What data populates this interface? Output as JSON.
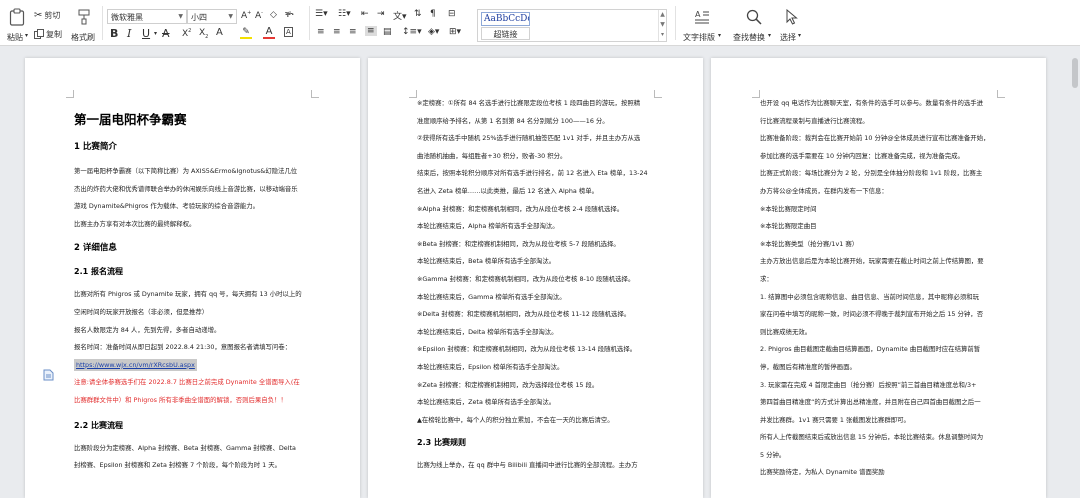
{
  "ribbon": {
    "paste": "粘贴",
    "cut": "剪切",
    "copy": "复制",
    "format_painter": "格式刷",
    "font_name": "微软雅黑",
    "font_size": "小四",
    "style_normal": "AaBbCcDd",
    "style_hyperlink": "超链接",
    "text_layout": "文字排版",
    "find_replace": "查找替换",
    "select": "选择",
    "colors": {
      "highlight": "#f3e000",
      "font_red": "#e53935",
      "brand_blue": "#2b579a"
    }
  },
  "page1": {
    "title": "第一届电阳杯争霸赛",
    "s1": "1  比赛简介",
    "s1_lines": [
      "第一届电阳杯争霸赛（以下简称比赛）为 AXIS5&Ermo&Ignotus&幻隐法几位",
      "杰出的炸药大佬和优秀谱师联合举办的休闲娱乐向线上音游比赛，以移动端音乐",
      "游戏 Dynamite&Phigros 作为载体、考验玩家的综合音游能力。",
      "比赛主办方享有对本次比赛的最终解释权。"
    ],
    "s2": "2  详细信息",
    "s21": "2.1  报名流程",
    "s21_lines": [
      "比赛对所有 Phigros 或 Dynamite 玩家，拥有 qq 号，每天拥有 13 小时以上的",
      "空闲时间的玩家开放报名（非必须，但是推荐）",
      "报名人数限定为 84 人，先到先得，多者自动递增。",
      "报名时间：准备时间从即日起到 2022.8.4 21:30，意图报名者请填写问卷："
    ],
    "link": "https://www.wjx.cn/vm/rXRcsbU.aspx",
    "warn1": "注意:请全体参赛选手们在 2022.8.7 比赛日之前完成 Dynamite 全谱面导入(在",
    "warn2": "比赛群群文件中）和 Phigros 所有非季曲全谱面的解锁，否则后果自负！！",
    "s22": "2.2  比赛流程",
    "s22_lines": [
      "比赛阶段分为定榜赛、Alpha 封榜赛、Beta 封榜赛、Gamma 封榜赛、Delta",
      "封榜赛、Epsilon 封榜赛和 Zeta 封榜赛 7 个阶段，每个阶段为时 1 天。"
    ]
  },
  "page2": {
    "lines_a": [
      "※定榜赛：①所有 84 名选手进行比赛限定段位考核 1 段四曲目的游玩，按照精",
      "准度顺序给予排名，从第 1 名到第 84 名分别赋分 100——16 分。",
      "②获得所有选手中随机 25%选手进行随机抽签匹配 1v1 对手，并且主办方从选",
      "曲池随机抽曲，每组胜者+30 积分，败者-30 积分。",
      "结束后，按照本轮积分顺序对所有选手进行排名，前 12 名进入 Eta 榜单，13-24",
      "名进入 Zeta 榜单……以此类推，最后 12 名进入 Alpha 榜单。",
      "※Alpha 封榜赛：和定榜赛机制相同，改为从段位考核 2-4 段随机选择。",
      "本轮比赛结束后，Alpha 榜单所有选手全部淘汰。",
      "※Beta 封榜赛：和定榜赛机制相同，改为从段位考核 5-7 段随机选择。",
      "本轮比赛结束后，Beta 榜单所有选手全部淘汰。",
      "※Gamma 封榜赛：和定榜赛机制相同，改为从段位考核 8-10 段随机选择。",
      "本轮比赛结束后，Gamma 榜单所有选手全部淘汰。",
      "※Delta 封榜赛：和定榜赛机制相同，改为从段位考核 11-12 段随机选择。",
      "本轮比赛结束后，Delta 榜单所有选手全部淘汰。",
      "※Epsilon 封榜赛：和定榜赛机制相同，改为从段位考核 13-14 段随机选择。",
      "本轮比赛结束后，Epsilon 榜单所有选手全部淘汰。",
      "※Zeta 封榜赛：和定榜赛机制相同，改为选择段位考核 15 段。",
      "本轮比赛结束后，Zeta 榜单所有选手全部淘汰。",
      "▲在榜轮比赛中，每个人的积分独立累加，不会在一天的比赛后清空。"
    ],
    "s23": "2.3  比赛规则",
    "lines_b": [
      "比赛为线上举办，在 qq 群中与 Bilibili 直播间中进行比赛的全部流程。主办方"
    ]
  },
  "page3": {
    "lines": [
      "也开设 qq 电话作为比赛聊天室，有条件的选手可以参与。数量有条件的选手进",
      "行比赛流程录制与直播进行比赛流程。",
      "比赛准备阶段：裁判会在比赛开始前 10 分钟@全体成员进行宣布比赛准备开始，",
      "参加比赛的选手需要在 10 分钟内回复：比赛准备完成，视为准备完成。",
      "比赛正式阶段：每场比赛分为 2 轮，分别是全体抽分阶段和 1v1 阶段，比赛主",
      "办方将公@全体成员，在群内发布一下信息：",
      "※本轮比赛限定时间",
      "※本轮比赛限定曲目",
      "※本轮比赛类型（抢分赛/1v1 赛）",
      "主办方放出信息后是为本轮比赛开始，玩家需要在截止时间之前上传结算图，要",
      "求：",
      "1. 结算图中必须包含昵称信息、曲目信息、当前时间信息，其中昵称必须和玩",
      "家在问卷中填写的昵称一致，时间必须不得晚于裁判宣布开始之后 15 分钟，否",
      "则比赛成绩无效。",
      "2. Phigros 曲目截图定截曲目结算画面，Dynamite 曲目截图时应在结算前暂",
      "停，截图后有精准度的暂停画面。",
      "3. 玩家需在完成 4 首限定曲目（抢分赛）后按照”前三首曲目精准度总和/3+",
      "第四首曲目精准度“的方式计算出总精准度，并且附在自己四首曲目截图之后一",
      "并发比赛群。1v1 赛只需要 1 张截图发比赛群即可。",
      "所有人上传截图结束后或放出信息 15 分钟后，本轮比赛结束。休息调整时间为",
      "5 分钟。",
      "比赛奖励待定，为私人 Dynamite 谱面奖励"
    ]
  }
}
